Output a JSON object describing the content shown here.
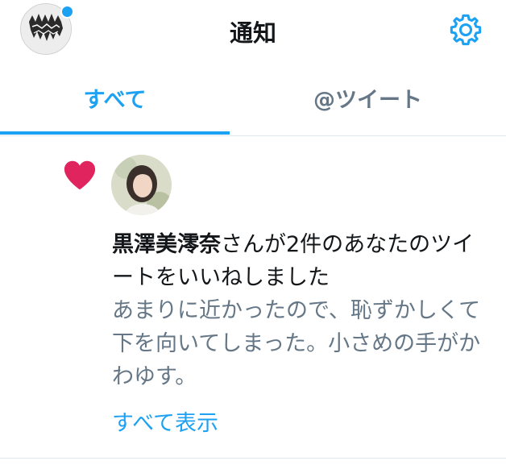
{
  "header": {
    "title": "通知",
    "avatar_icon": "profile-avatar-icon",
    "settings_icon": "gear-icon",
    "notification_dot_color": "#1da1f2"
  },
  "tabs": [
    {
      "label": "すべて",
      "active": true
    },
    {
      "label": "@ツイート",
      "active": false
    }
  ],
  "notification": {
    "type_icon": "heart-icon",
    "heart_color": "#e0245e",
    "user_name": "黒澤美澪奈",
    "action_text": "さんが2件のあなたのツイートをいいねしました",
    "tweet_preview": "あまりに近かったので、恥ずかしくて下を向いてしまった。小さめの手がかわゆす。",
    "show_all_label": "すべて表示"
  },
  "colors": {
    "accent": "#1da1f2",
    "secondary_text": "#657786",
    "primary_text": "#14171a",
    "divider": "#e1e8ed"
  }
}
